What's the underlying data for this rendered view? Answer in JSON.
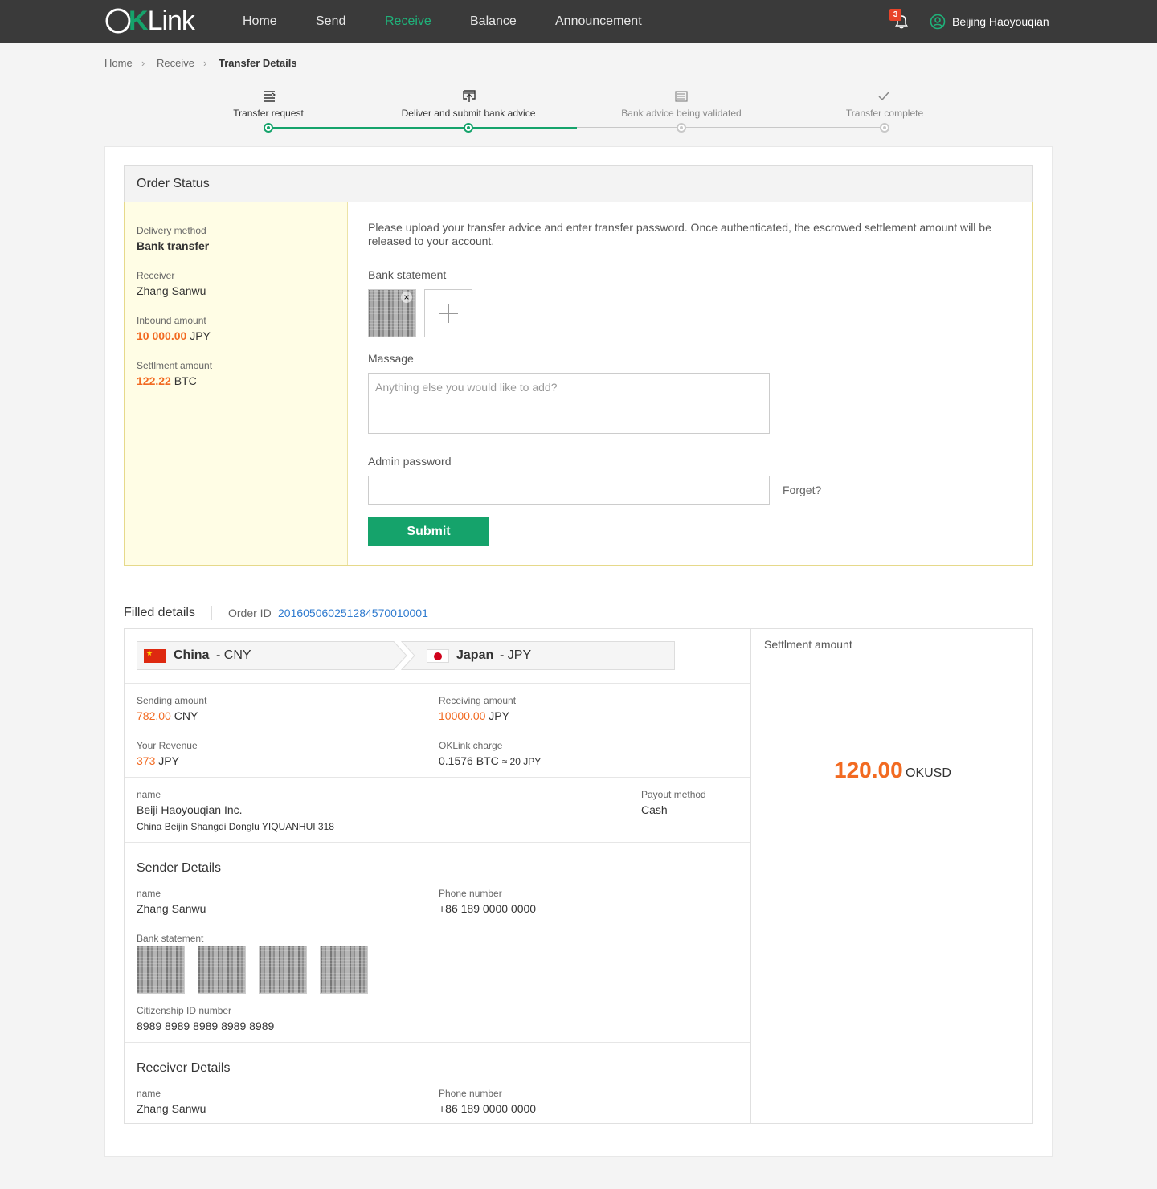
{
  "nav": {
    "logo_ok": "OK",
    "logo_link": "Link",
    "items": [
      "Home",
      "Send",
      "Receive",
      "Balance",
      "Announcement"
    ],
    "active": "Receive",
    "notification_count": "3",
    "user": "Beijing  Haoyouqian"
  },
  "breadcrumb": [
    "Home",
    "Receive",
    "Transfer Details"
  ],
  "steps": [
    {
      "label": "Transfer request",
      "icon": "list-icon",
      "state": "done"
    },
    {
      "label": "Deliver and submit bank advice",
      "icon": "upload-icon",
      "state": "done"
    },
    {
      "label": "Bank advice being validated",
      "icon": "document-icon",
      "state": "todo"
    },
    {
      "label": "Transfer complete",
      "icon": "check-icon",
      "state": "todo"
    }
  ],
  "order_status": {
    "title": "Order Status",
    "delivery_label": "Delivery method",
    "delivery_value": "Bank transfer",
    "receiver_label": "Receiver",
    "receiver_value": "Zhang Sanwu",
    "inbound_label": "Inbound amount",
    "inbound_amount": "10 000.00",
    "inbound_currency": "JPY",
    "settlement_label": "Settlment amount",
    "settlement_amount": "122.22",
    "settlement_currency": "BTC",
    "intro": "Please upload your transfer advice and enter transfer password. Once authenticated, the escrowed settlement amount will be released to your account.",
    "bank_statement_label": "Bank statement",
    "remove_symbol": "×",
    "message_label": "Massage",
    "message_placeholder": "Anything else you would like to add?",
    "password_label": "Admin password",
    "forget": "Forget?",
    "submit": "Submit"
  },
  "filled": {
    "title": "Filled details",
    "order_id_label": "Order ID",
    "order_id": "201605060251284570010001",
    "from_country": "China",
    "from_currency": "- CNY",
    "to_country": "Japan",
    "to_currency": "- JPY",
    "sending_label": "Sending amount",
    "sending_amount": "782.00",
    "sending_currency": "CNY",
    "receiving_label": "Receiving amount",
    "receiving_amount": "10000.00",
    "receiving_currency": "JPY",
    "revenue_label": "Your Revenue",
    "revenue_amount": "373",
    "revenue_currency": "JPY",
    "charge_label": "OKLink charge",
    "charge_value": "0.1576 BTC",
    "charge_approx": "≈ 20 JPY",
    "name_label": "name",
    "company": "Beiji Haoyouqian Inc.",
    "address": "China  Beijin  Shangdi Donglu YIQUANHUI 318",
    "payout_label": "Payout method",
    "payout_value": "Cash",
    "settlement_label": "Settlment amount",
    "settlement_amount": "120.00",
    "settlement_unit": "OKUSD"
  },
  "sender": {
    "title": "Sender Details",
    "name_label": "name",
    "name": "Zhang Sanwu",
    "phone_label": "Phone number",
    "phone": "+86 189 0000 0000",
    "bank_label": "Bank statement",
    "id_label": "Citizenship ID number",
    "id_number": "8989 8989 8989 8989 8989"
  },
  "receiver": {
    "title": "Receiver Details",
    "name_label": "name",
    "name": "Zhang Sanwu",
    "phone_label": "Phone number",
    "phone": "+86 189 0000 0000"
  },
  "colors": {
    "nav_bg": "#3a3a3a",
    "accent_green": "#15a36b",
    "amount_orange": "#f26a21",
    "link_blue": "#2f7bcf",
    "highlight_yellow": "#fffde5"
  }
}
